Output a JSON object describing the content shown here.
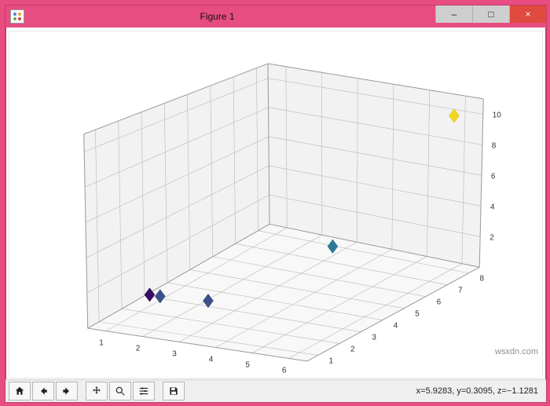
{
  "window": {
    "title": "Figure 1",
    "controls": {
      "minimize": "–",
      "maximize": "□",
      "close": "×"
    }
  },
  "toolbar": {
    "buttons": {
      "home": {
        "name": "home-icon"
      },
      "back": {
        "name": "arrow-left-icon"
      },
      "forward": {
        "name": "arrow-right-icon"
      },
      "pan": {
        "name": "move-icon"
      },
      "zoom": {
        "name": "magnify-icon"
      },
      "subplots": {
        "name": "sliders-icon"
      },
      "save": {
        "name": "save-icon"
      }
    },
    "coords_text": "x=5.9283, y=0.3095, z=−1.1281"
  },
  "watermark": "wsxdn.com",
  "chart_data": {
    "type": "scatter",
    "projection": "3d",
    "marker": "D",
    "x_ticks": [
      1,
      2,
      3,
      4,
      5,
      6
    ],
    "y_ticks": [
      1,
      2,
      3,
      4,
      5,
      6,
      7,
      8
    ],
    "z_ticks": [
      2,
      4,
      6,
      8,
      10
    ],
    "x_range": [
      0.5,
      6.5
    ],
    "y_range": [
      0.5,
      8.5
    ],
    "z_range": [
      0,
      11
    ],
    "points": [
      {
        "x": 1.9,
        "y": 1.0,
        "z": 2.0,
        "color": "#3a0b63"
      },
      {
        "x": 1.5,
        "y": 2.1,
        "z": 1.0,
        "color": "#3b4f8a"
      },
      {
        "x": 2.7,
        "y": 2.3,
        "z": 1.0,
        "color": "#3b4f8a"
      },
      {
        "x": 4.8,
        "y": 4.5,
        "z": 3.5,
        "color": "#2e7a96"
      },
      {
        "x": 6.0,
        "y": 8.0,
        "z": 10.0,
        "color": "#f2d51c"
      }
    ]
  }
}
